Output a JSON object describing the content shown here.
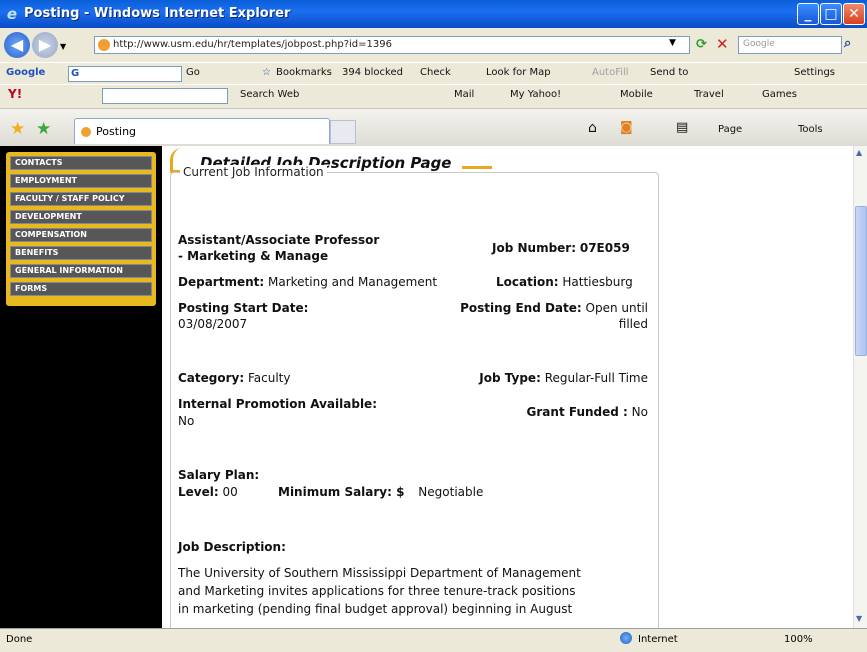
{
  "window": {
    "title": "Posting - Windows Internet Explorer"
  },
  "address_bar": {
    "url": "http://www.usm.edu/hr/templates/jobpost.php?id=1396",
    "search_placeholder": "Google"
  },
  "google_toolbar": {
    "brand": "Google",
    "g_menu": "G",
    "go_label": "Go",
    "bookmarks": "Bookmarks",
    "blocked": "394 blocked",
    "check": "Check",
    "look_for_map": "Look for Map",
    "autofill": "AutoFill",
    "send_to": "Send to",
    "settings": "Settings"
  },
  "yahoo_toolbar": {
    "brand": "Y!",
    "search_web": "Search Web",
    "mail": "Mail",
    "my_yahoo": "My Yahoo!",
    "mobile": "Mobile",
    "travel": "Travel",
    "games": "Games"
  },
  "tabs": [
    {
      "label": "Posting"
    }
  ],
  "command_bar": {
    "page": "Page",
    "tools": "Tools"
  },
  "sidebar_menu": [
    "CONTACTS",
    "EMPLOYMENT",
    "FACULTY / STAFF POLICY",
    "DEVELOPMENT",
    "COMPENSATION",
    "BENEFITS",
    "GENERAL INFORMATION",
    "FORMS"
  ],
  "page": {
    "heading": "Detailed Job Description Page",
    "legend": "Current Job Information",
    "job_title_line1": "Assistant/Associate Professor",
    "job_title_line2": "- Marketing & Manage",
    "job_number_label": "Job Number:",
    "job_number": "07E059",
    "department_label": "Department:",
    "department": "Marketing and Management",
    "location_label": "Location:",
    "location": "Hattiesburg",
    "posting_start_label": "Posting Start Date:",
    "posting_start": "03/08/2007",
    "posting_end_label": "Posting End Date:",
    "posting_end_line1": "Open until",
    "posting_end_line2": "filled",
    "category_label": "Category:",
    "category": "Faculty",
    "job_type_label": "Job Type:",
    "job_type": "Regular-Full Time",
    "internal_promo_label": "Internal Promotion Available:",
    "internal_promo": "No",
    "grant_funded_label": "Grant Funded :",
    "grant_funded": "No",
    "salary_plan_label": "Salary Plan:",
    "level_label": "Level:",
    "level": "00",
    "min_salary_label": "Minimum Salary: $",
    "min_salary": "Negotiable",
    "job_description_label": "Job Description:",
    "job_description_lines": [
      "The University of Southern Mississippi Department of Management",
      "and Marketing invites applications for three tenure-track positions",
      "in marketing (pending final budget approval) beginning in August"
    ]
  },
  "status_bar": {
    "status": "Done",
    "zone": "Internet",
    "zoom": "100%"
  }
}
